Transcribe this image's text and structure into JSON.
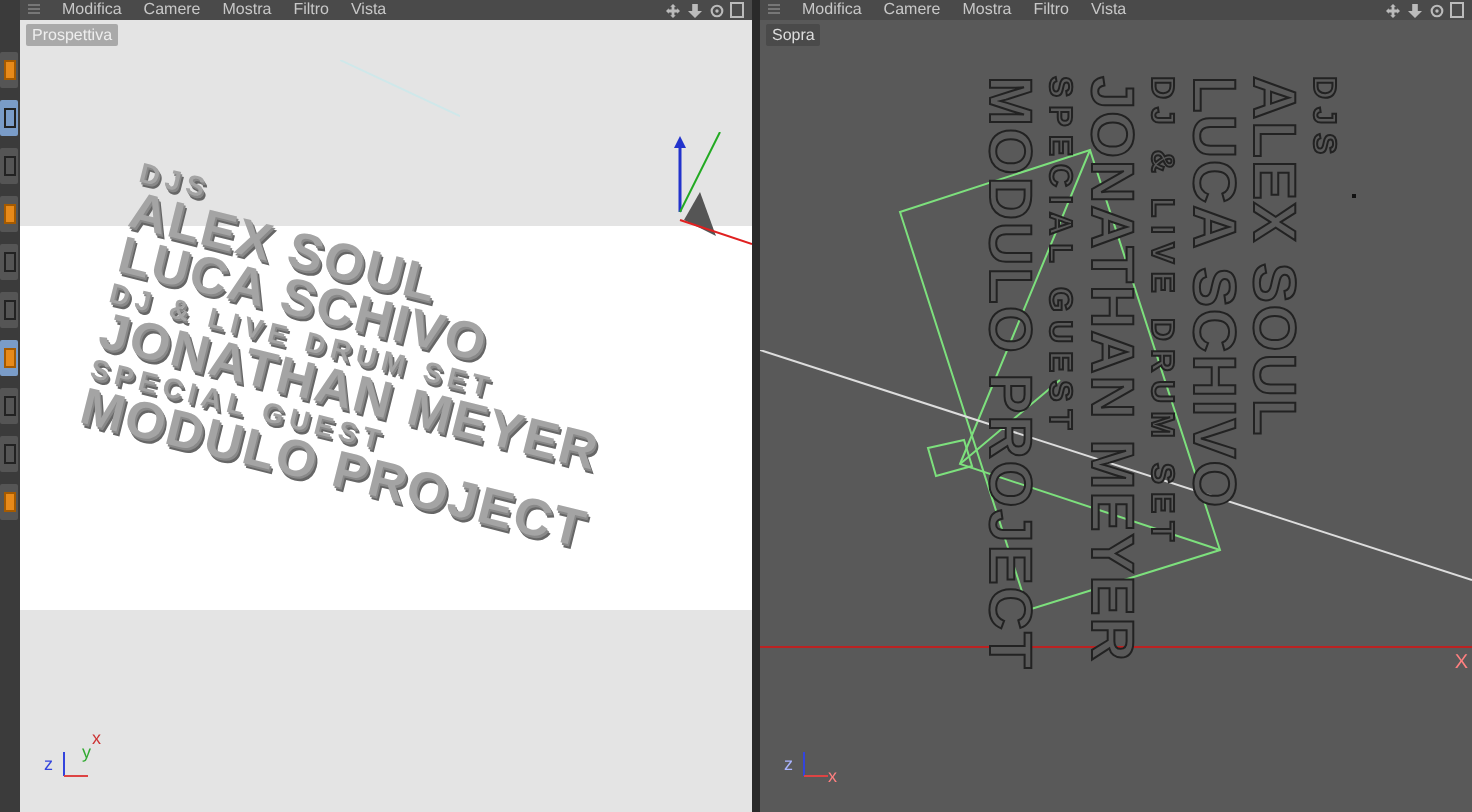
{
  "tools": [
    {
      "selected": false
    },
    {
      "selected": true
    },
    {
      "selected": false
    },
    {
      "selected": false
    },
    {
      "selected": false
    },
    {
      "selected": false
    },
    {
      "selected": true
    },
    {
      "selected": false
    },
    {
      "selected": false
    },
    {
      "selected": false
    }
  ],
  "views": [
    {
      "kind": "perspective",
      "menu": [
        "Modifica",
        "Camere",
        "Mostra",
        "Filtro",
        "Vista"
      ],
      "label": "Prospettiva",
      "axes": [
        "z",
        "y",
        "x"
      ],
      "text_lines": [
        {
          "text": "DJS",
          "kind": "small"
        },
        {
          "text": "ALEX SOUL",
          "kind": "large"
        },
        {
          "text": "LUCA SCHIVO",
          "kind": "large"
        },
        {
          "text": "DJ & LIVE DRUM SET",
          "kind": "small"
        },
        {
          "text": "JONATHAN MEYER",
          "kind": "large"
        },
        {
          "text": "SPECIAL GUEST",
          "kind": "small"
        },
        {
          "text": "MODULO PROJECT",
          "kind": "large"
        }
      ]
    },
    {
      "kind": "top",
      "menu": [
        "Modifica",
        "Camere",
        "Mostra",
        "Filtro",
        "Vista"
      ],
      "label": "Sopra",
      "axes": [
        "z",
        "x"
      ],
      "axis_end": "X",
      "text_lines": [
        {
          "text": "DJS",
          "kind": "small"
        },
        {
          "text": "ALEX SOUL",
          "kind": "large"
        },
        {
          "text": "LUCA SCHIVO",
          "kind": "large"
        },
        {
          "text": "DJ & LIVE DRUM SET",
          "kind": "small"
        },
        {
          "text": "JONATHAN MEYER",
          "kind": "large"
        },
        {
          "text": "SPECIAL GUEST",
          "kind": "small"
        },
        {
          "text": "MODULO PROJECT",
          "kind": "large"
        }
      ]
    }
  ]
}
